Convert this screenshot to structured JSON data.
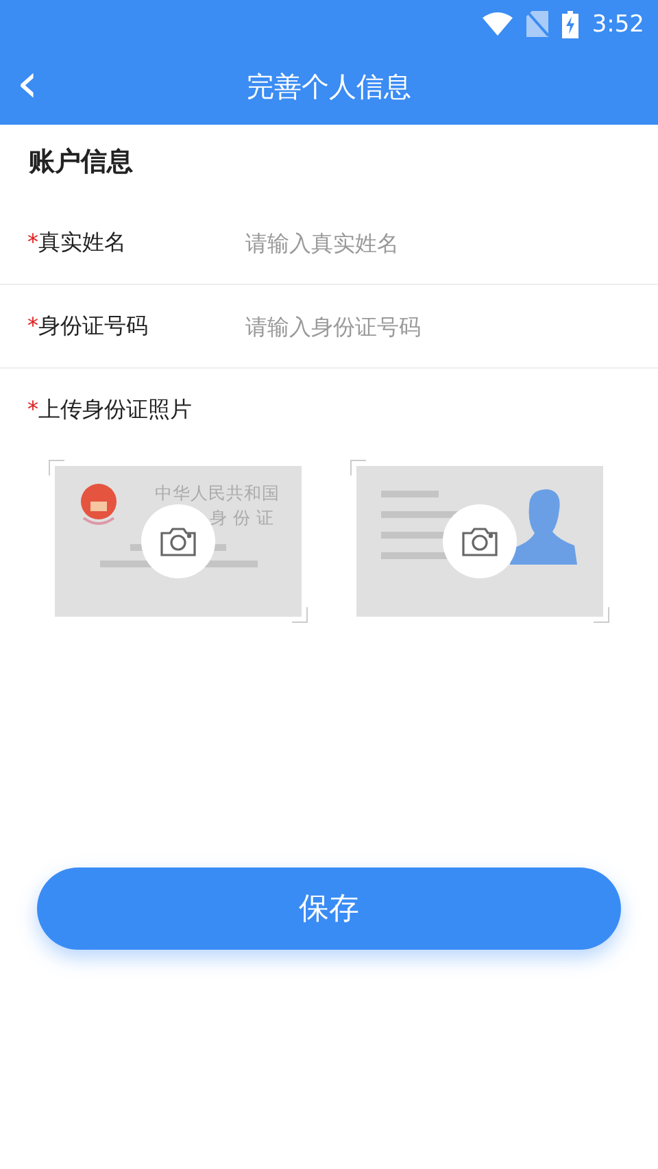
{
  "status_bar": {
    "time": "3:52"
  },
  "header": {
    "back": "‹",
    "title": "完善个人信息"
  },
  "section_title": "账户信息",
  "required_mark": "*",
  "fields": [
    {
      "required": true,
      "label": "真实姓名",
      "placeholder": "请输入真实姓名"
    },
    {
      "required": true,
      "label": "身份证号码",
      "placeholder": "请输入身份证号码"
    }
  ],
  "upload": {
    "required": true,
    "label": "上传身份证照片",
    "front_card": {
      "line_1": "中华人民共和国",
      "line_2": "身 份 证"
    }
  },
  "save_button": "保存"
}
